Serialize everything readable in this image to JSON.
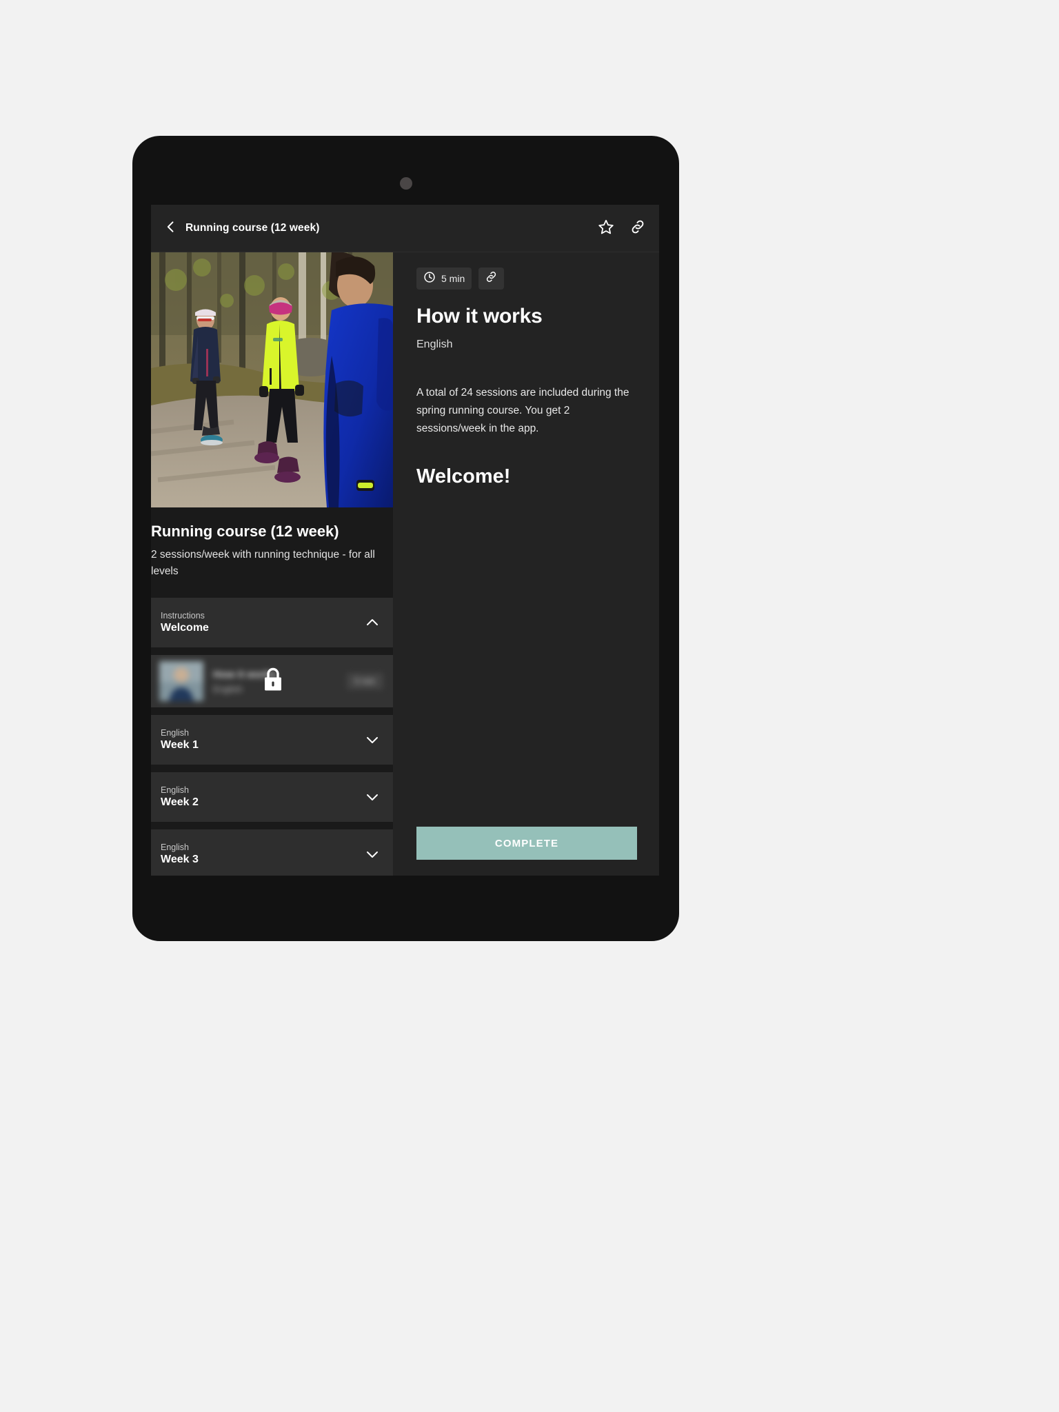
{
  "app_bar": {
    "title": "Running course (12 week)",
    "back_icon": "chevron-left-icon",
    "favorite_icon": "star-outline-icon",
    "share_icon": "link-icon"
  },
  "left_panel": {
    "hero_alt": "three runners on a forest gravel trail",
    "course_title": "Running course (12 week)",
    "course_subtitle": "2 sessions/week with running technique - for all levels",
    "sections": [
      {
        "eyebrow": "Instructions",
        "title": "Welcome",
        "chevron": "chevron-up-icon",
        "expanded": true
      },
      {
        "eyebrow": "English",
        "title": "Week 1",
        "chevron": "chevron-down-icon",
        "expanded": false
      },
      {
        "eyebrow": "English",
        "title": "Week 2",
        "chevron": "chevron-down-icon",
        "expanded": false
      },
      {
        "eyebrow": "English",
        "title": "Week 3",
        "chevron": "chevron-down-icon",
        "expanded": false
      }
    ],
    "lesson": {
      "title": "How it works",
      "language": "English",
      "duration": "5 min",
      "lock_icon": "lock-icon",
      "locked": true
    }
  },
  "right_panel": {
    "duration_chip": {
      "icon": "clock-icon",
      "label": "5 min"
    },
    "share_chip": {
      "icon": "link-icon"
    },
    "title": "How it works",
    "language": "English",
    "paragraph": "A total of 24 sessions are included during the spring running course. You get 2 sessions/week in the app.",
    "welcome_heading": "Welcome!",
    "complete_button": "COMPLETE"
  },
  "colors": {
    "page_background": "#f2f2f2",
    "device_body": "#121212",
    "app_background": "#1a1a1a",
    "app_bar": "#242424",
    "right_panel": "#232323",
    "card": "#2e2e2e",
    "accent_button": "#95c0b9",
    "text_primary": "#ffffff",
    "text_secondary": "#c8c8c8"
  }
}
